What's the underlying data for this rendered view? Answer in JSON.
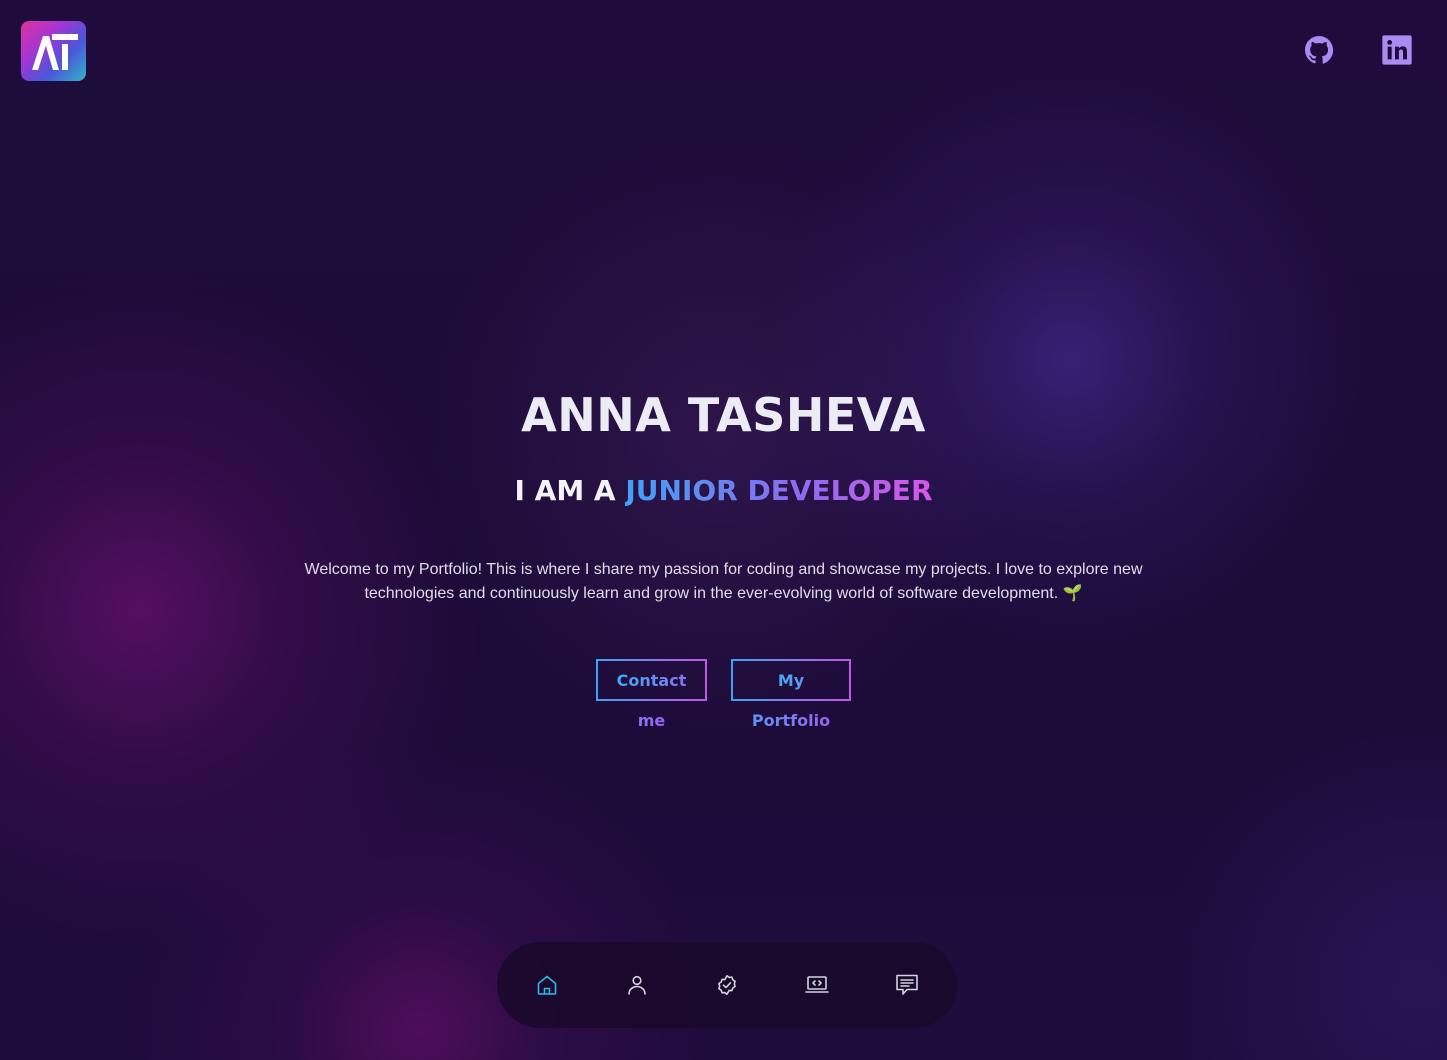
{
  "header": {
    "logo_text": "AT",
    "social": [
      {
        "name": "GitHub",
        "icon": "github-icon"
      },
      {
        "name": "LinkedIn",
        "icon": "linkedin-icon"
      }
    ]
  },
  "hero": {
    "name": "ANNA TASHEVA",
    "role_prefix": "I AM A",
    "role_highlight": "JUNIOR DEVELOPER",
    "intro_line1": "Welcome to my Portfolio! This is where I share my passion for coding and showcase my projects. I love to explore new",
    "intro_line2": "technologies and continuously learn and grow in the ever-evolving world of software development. 🌱",
    "buttons": {
      "contact": "Contact me",
      "portfolio": "My Portfolio"
    }
  },
  "bottom_nav": {
    "items": [
      {
        "icon": "home-icon",
        "active": true
      },
      {
        "icon": "user-icon",
        "active": false
      },
      {
        "icon": "badge-check-icon",
        "active": false
      },
      {
        "icon": "laptop-code-icon",
        "active": false
      },
      {
        "icon": "message-icon",
        "active": false
      }
    ],
    "active_color": "#2fb8f0",
    "inactive_color": "#d6d2e2"
  },
  "colors": {
    "background": "#1d0d3a",
    "accent_blue": "#3fa3f5",
    "accent_purple": "#8a6df0",
    "accent_pink": "#d957e6",
    "social_icon": "#a98bf2"
  }
}
